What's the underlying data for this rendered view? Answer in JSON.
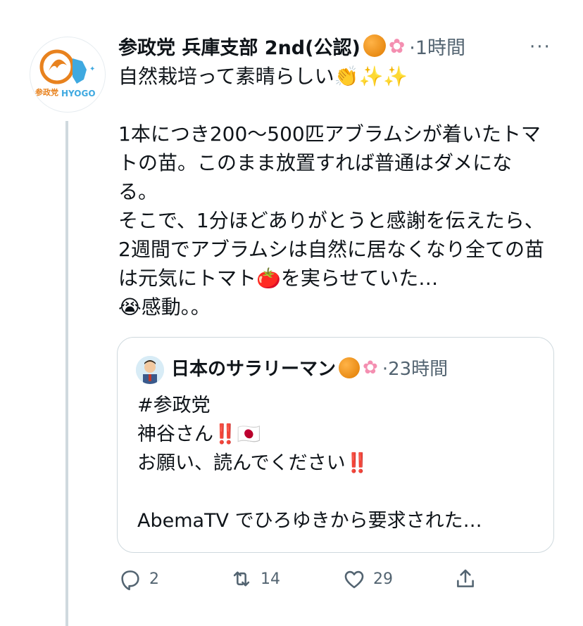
{
  "tweet": {
    "author_name": "参政党 兵庫支部 2nd(公認)",
    "avatar_label": "参政党",
    "avatar_sub": "HYOGO",
    "time": "·1時間",
    "more": "···",
    "text": "自然栽培って素晴らしい👏✨✨\n\n1本につき200〜500匹アブラムシが着いたトマトの苗。このまま放置すれば普通はダメになる。\nそこで、1分ほどありがとうと感謝を伝えたら、2週間でアブラムシは自然に居なくなり全ての苗は元気にトマト🍅を実らせていた…\n😭感動。。"
  },
  "quote": {
    "author_name": "日本のサラリーマン",
    "time": "·23時間",
    "text": "#参政党\n神谷さん‼️🇯🇵\nお願い、読んでください‼️\n\nAbemaTV でひろゆきから要求された…"
  },
  "actions": {
    "reply_count": "2",
    "retweet_count": "14",
    "like_count": "29"
  },
  "colors": {
    "secondary": "#536471",
    "border": "#cfd9de",
    "logo_orange": "#e8821e",
    "logo_blue": "#3fa9e0"
  },
  "icons": [
    "reply-icon",
    "retweet-icon",
    "like-icon",
    "share-icon",
    "more-icon"
  ]
}
